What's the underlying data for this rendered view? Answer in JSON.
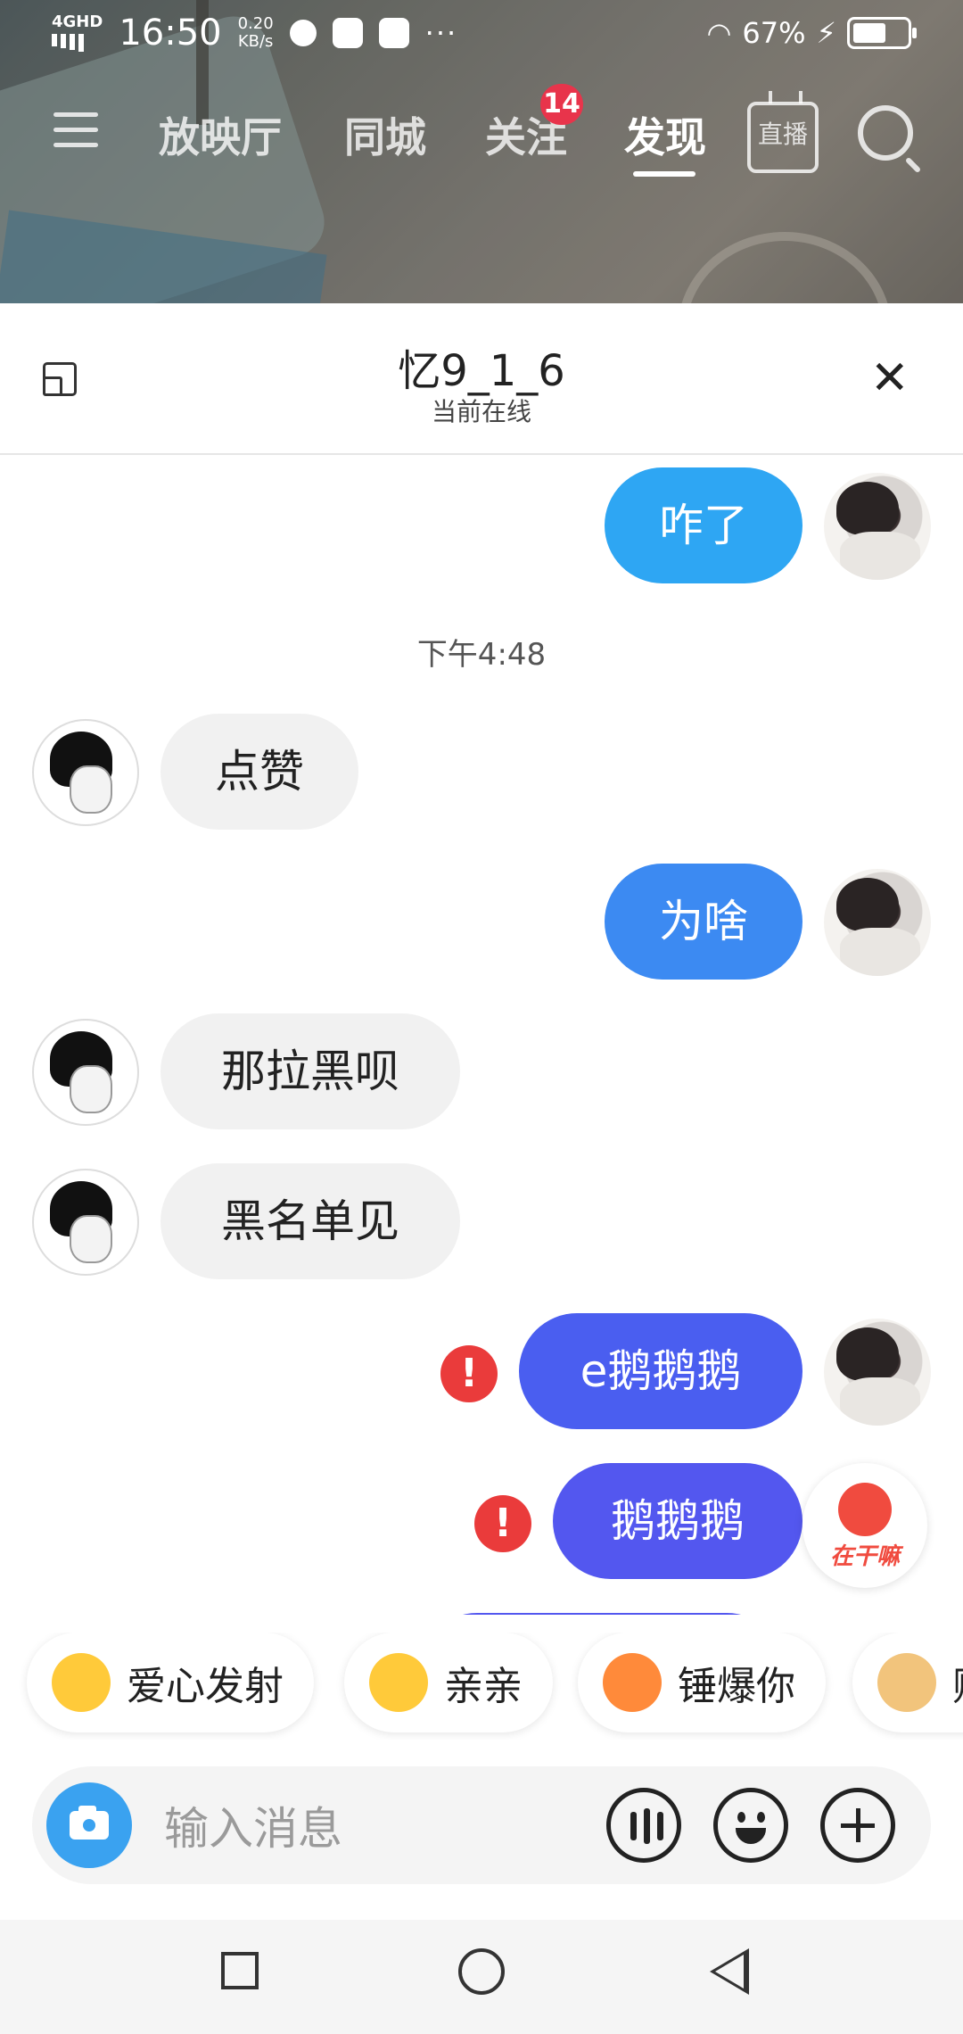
{
  "status_bar": {
    "network": "4GHD",
    "time": "16:50",
    "speed_value": "0.20",
    "speed_unit": "KB/s",
    "more": "···",
    "battery": "67%",
    "battery_level": 0.67
  },
  "top_nav": {
    "tabs": [
      "放映厅",
      "同城",
      "关注",
      "发现"
    ],
    "active_tab": "发现",
    "follow_badge": "14",
    "live_label": "直播"
  },
  "chat": {
    "title": "忆9_1_6",
    "subtitle": "当前在线",
    "timestamp": "下午4:48",
    "messages": [
      {
        "from": "me",
        "text": "咋了",
        "color": "#2ea6f3"
      },
      {
        "from": "other",
        "text": "点赞"
      },
      {
        "from": "me",
        "text": "为啥",
        "color": "#3c8af2"
      },
      {
        "from": "other",
        "text": "那拉黑呗"
      },
      {
        "from": "other",
        "text": "黑名单见"
      },
      {
        "from": "me",
        "text": "e鹅鹅鹅",
        "color": "#4a5ef0",
        "failed": true
      },
      {
        "from": "me",
        "text": "鹅鹅鹅",
        "color": "#5357ef",
        "failed": true
      }
    ],
    "error_mark": "!"
  },
  "floating": {
    "label": "在干嘛"
  },
  "quick_replies": [
    "爱心发射",
    "亲亲",
    "锤爆你",
    "贴"
  ],
  "input": {
    "placeholder": "输入消息"
  },
  "icons": {
    "menu": "menu-icon",
    "search": "search-icon",
    "camera": "camera-icon",
    "voice": "voice-icon",
    "emoji": "emoji-icon",
    "plus": "plus-icon",
    "close": "close-icon",
    "minimize": "minimize-icon"
  }
}
